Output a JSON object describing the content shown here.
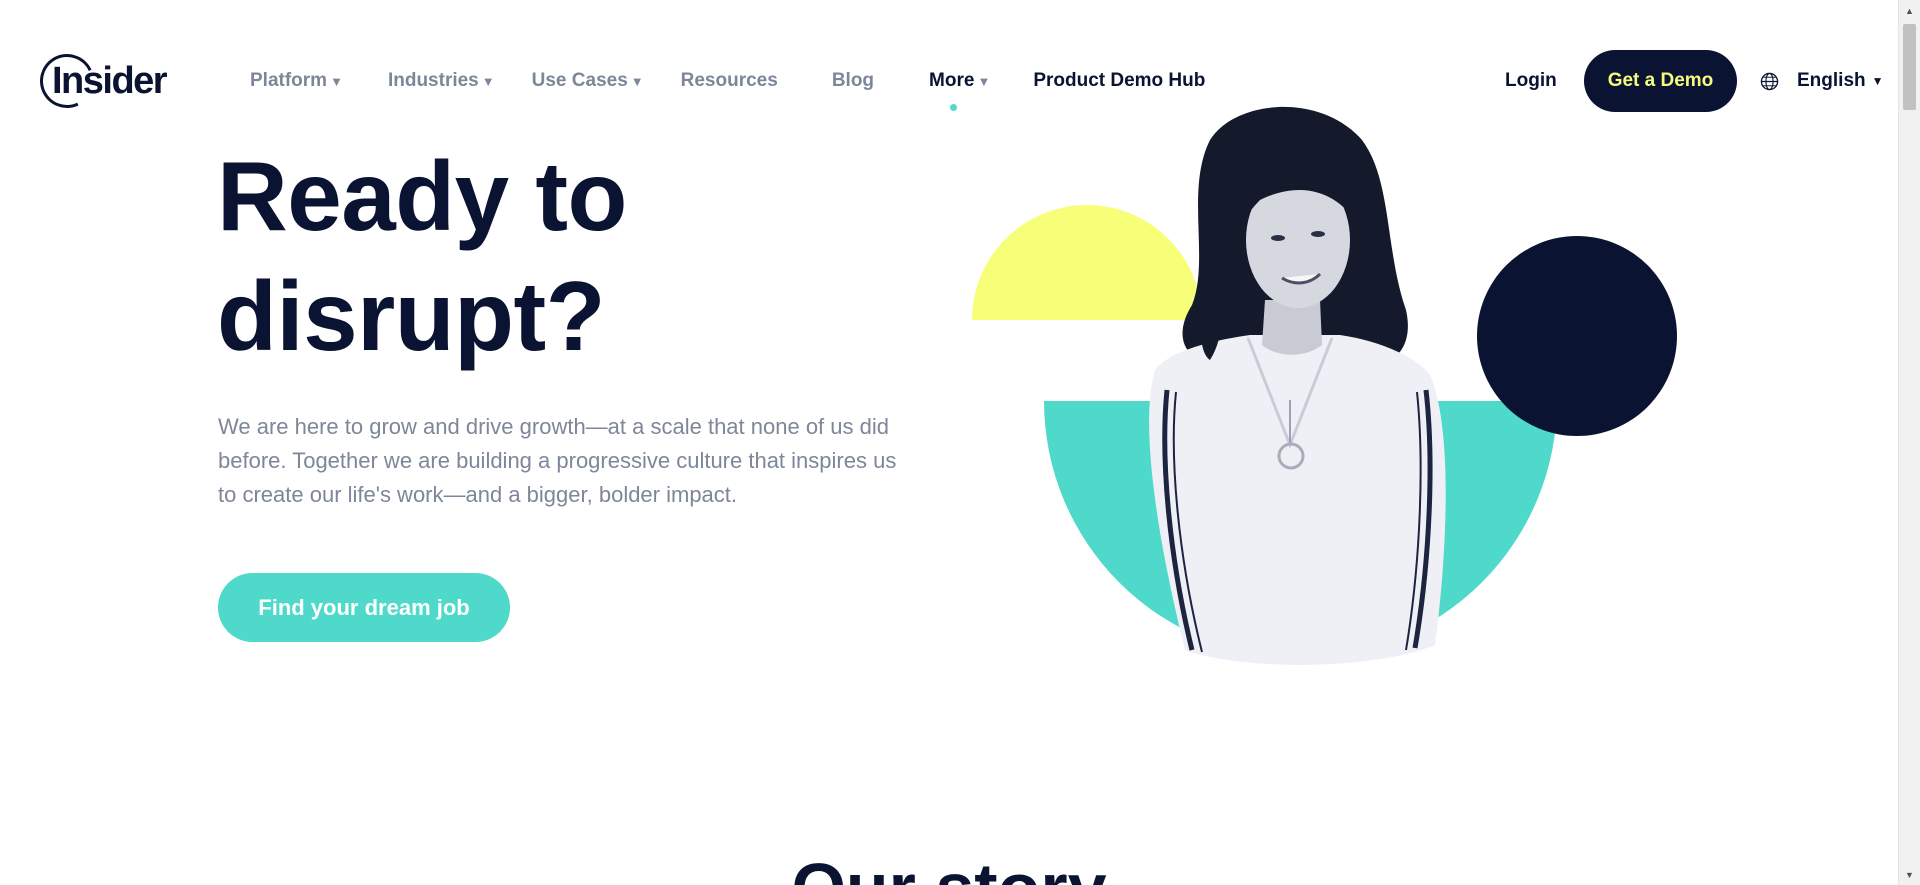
{
  "header": {
    "logo_text": "Insider",
    "nav": [
      {
        "label": "Platform",
        "caret": "▼"
      },
      {
        "label": "Industries",
        "caret": "▼"
      },
      {
        "label": "Use Cases",
        "caret": "▼"
      },
      {
        "label": "Resources"
      },
      {
        "label": "Blog"
      },
      {
        "label": "More",
        "caret": "▼"
      },
      {
        "label": "Product Demo Hub"
      }
    ],
    "login": "Login",
    "demo_button": "Get a Demo",
    "language": "English",
    "language_caret": "▼",
    "globe_icon": "globe-icon"
  },
  "hero": {
    "title_line1": "Ready to",
    "title_line2": "disrupt?",
    "text": "We are here to grow and drive growth—at a scale that none of us did before. Together we are building a progressive culture that inspires us to create our life's work—and a bigger, bolder impact.",
    "cta": "Find your dream job"
  },
  "illustration": {
    "yellow_color": "#f7ff78",
    "teal_color": "#4fd9cb",
    "navy_color": "#0a1331"
  },
  "next_section_title": "Our story",
  "scrollbar": {
    "up": "▲",
    "down": "▼"
  }
}
